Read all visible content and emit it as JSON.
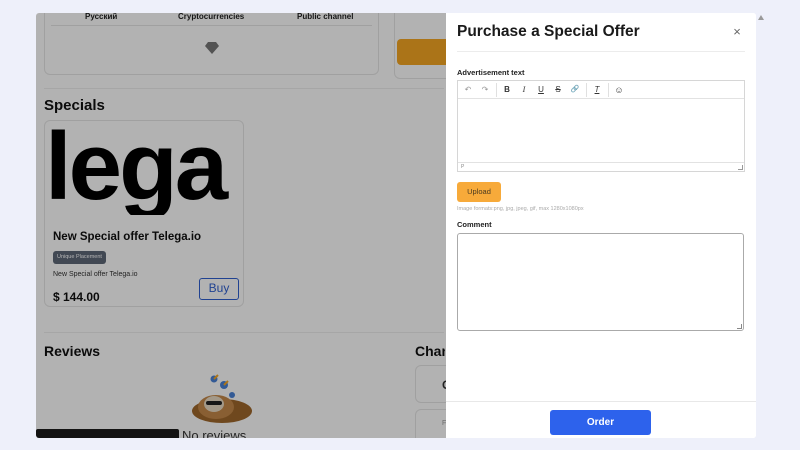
{
  "background": {
    "channel_info": {
      "language": "Русский",
      "category": "Cryptocurrencies",
      "type": "Public channel"
    },
    "specials": {
      "title": "Specials",
      "offer": {
        "image_text": "lega",
        "name": "New Special offer Telega.io",
        "badge": "Unique Placement",
        "description": "New Special offer Telega.io",
        "price": "$ 144.00",
        "buy_label": "Buy"
      }
    },
    "reviews": {
      "title": "Reviews",
      "empty_text": "No reviews"
    },
    "channels_title": "Channels",
    "side_cards": [
      "C",
      "F"
    ]
  },
  "modal": {
    "title": "Purchase a Special Offer",
    "close_symbol": "×",
    "ad_text_label": "Advertisement text",
    "toolbar": {
      "undo": "↶",
      "redo": "↷",
      "bold": "B",
      "italic": "I",
      "underline": "U",
      "strike": "S",
      "link": "🔗",
      "clear_format": "T",
      "emoji": "☺"
    },
    "editor_status": "P",
    "upload_label": "Upload",
    "upload_hint": "Image formats:png, jpg, jpeg, gif, max 1280x1080px",
    "comment_label": "Comment",
    "order_label": "Order"
  },
  "colors": {
    "primary": "#2d62ec",
    "upload": "#f7aa3a",
    "badge": "#5d6778"
  }
}
